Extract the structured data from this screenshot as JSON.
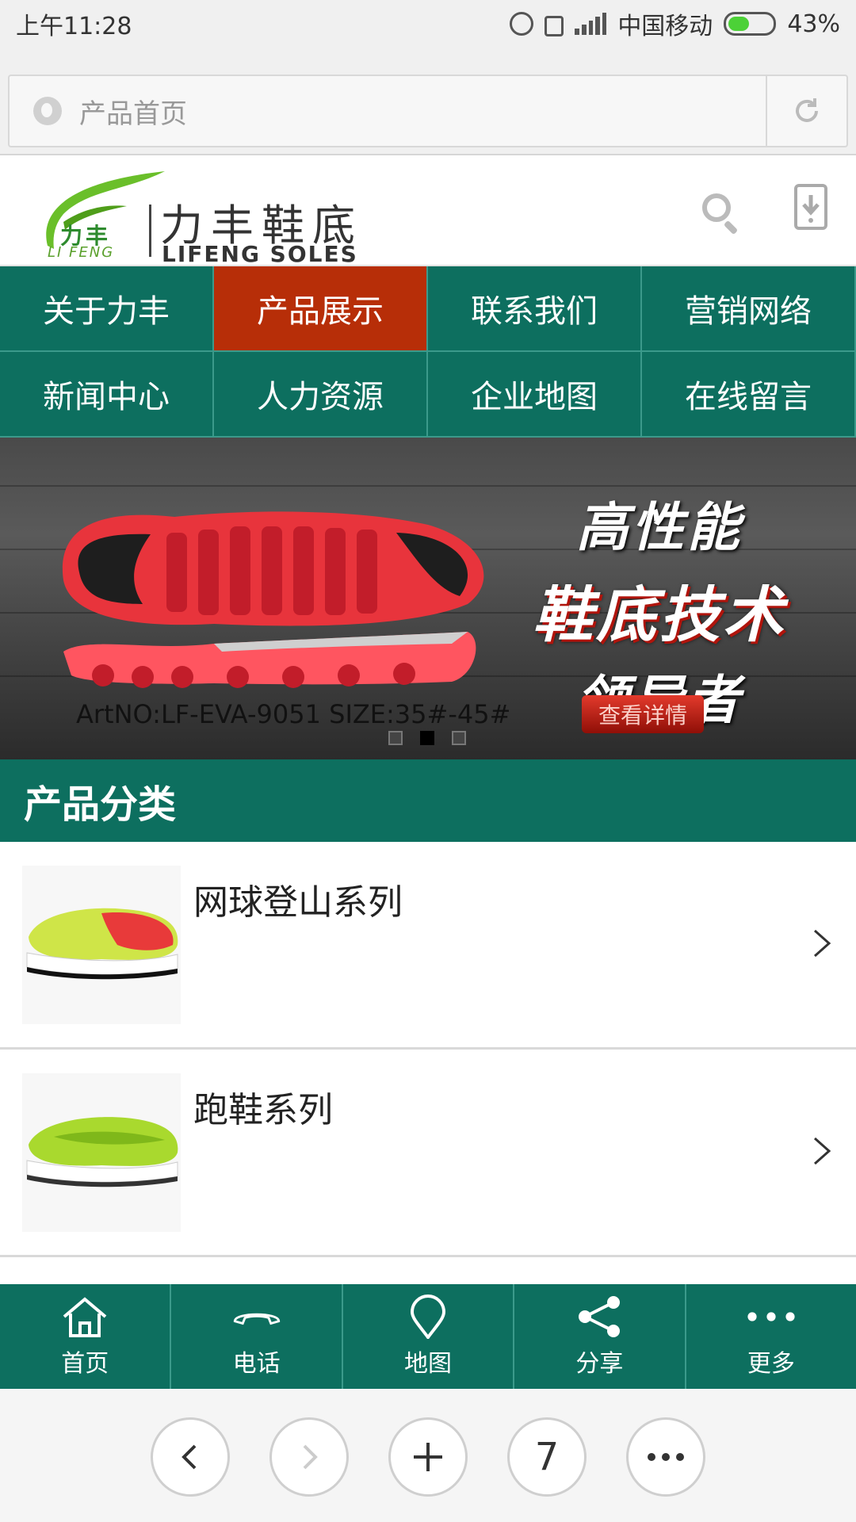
{
  "status_bar": {
    "time": "上午11:28",
    "carrier": "中国移动",
    "battery": "43%",
    "battery_level": 0.43
  },
  "address_bar": {
    "title": "产品首页",
    "reload_icon": "reload-icon"
  },
  "header": {
    "logo_small_cn": "力丰",
    "logo_small_en": "LI FENG",
    "logo_cn": "力丰鞋底",
    "logo_en": "LIFENG SOLES"
  },
  "nav": {
    "items": [
      {
        "label": "关于力丰",
        "active": false
      },
      {
        "label": "产品展示",
        "active": true
      },
      {
        "label": "联系我们",
        "active": false
      },
      {
        "label": "营销网络",
        "active": false
      },
      {
        "label": "新闻中心",
        "active": false
      },
      {
        "label": "人力资源",
        "active": false
      },
      {
        "label": "企业地图",
        "active": false
      },
      {
        "label": "在线留言",
        "active": false
      }
    ]
  },
  "banner": {
    "line1": "高性能",
    "line2": "鞋底技术",
    "line3": "领导者",
    "caption": "ArtNO:LF-EVA-9051  SIZE:35#-45#",
    "detail_button": "查看详情",
    "slides": 3,
    "active_slide": 2
  },
  "section": {
    "title": "产品分类"
  },
  "products": [
    {
      "title": "网球登山系列"
    },
    {
      "title": "跑鞋系列"
    }
  ],
  "bottom_nav": [
    {
      "label": "首页",
      "icon": "home-icon"
    },
    {
      "label": "电话",
      "icon": "phone-icon"
    },
    {
      "label": "地图",
      "icon": "map-pin-icon"
    },
    {
      "label": "分享",
      "icon": "share-icon"
    },
    {
      "label": "更多",
      "icon": "more-icon"
    }
  ],
  "browser_toolbar": {
    "tabs_count": "7",
    "buttons": [
      "back-icon",
      "forward-icon",
      "new-tab-icon",
      "tabs-count",
      "menu-icon"
    ]
  },
  "colors": {
    "brand_green": "#0d6f5f",
    "active_nav": "#b72e08"
  }
}
